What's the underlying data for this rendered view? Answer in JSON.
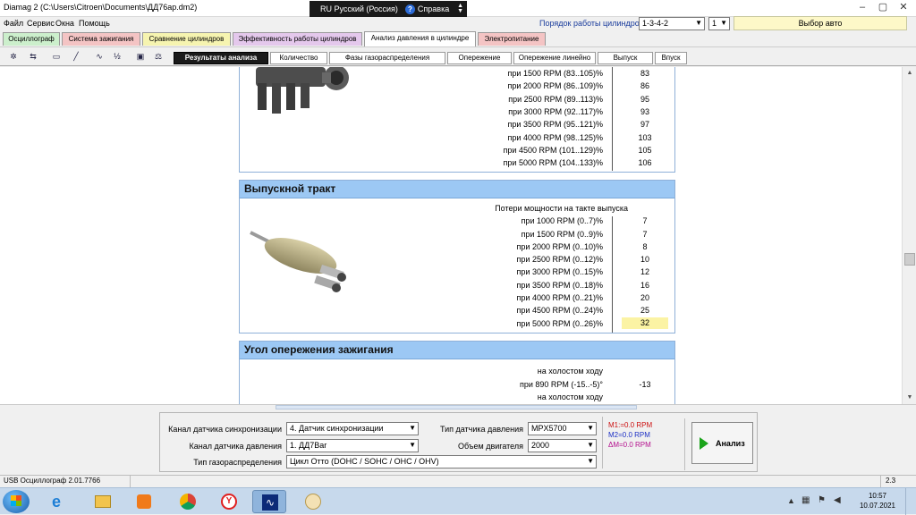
{
  "window": {
    "title": "Diamag 2 (C:\\Users\\Citroen\\Documents\\ДД76ар.dm2)"
  },
  "langbar": {
    "language": "RU Русский (Россия)",
    "help": "Справка"
  },
  "menu": [
    "Файл",
    "Сервис",
    "Окна",
    "Помощь"
  ],
  "cylinders": {
    "label": "Порядок работы цилиндров",
    "order": "1-3-4-2",
    "number": "1",
    "choose_auto": "Выбор авто"
  },
  "tabs": [
    {
      "label": "Осциллограф",
      "color": "#ccefcc"
    },
    {
      "label": "Система зажигания",
      "color": "#f4c4c4"
    },
    {
      "label": "Сравнение цилиндров",
      "color": "#f6f4b0"
    },
    {
      "label": "Эффективность работы цилиндров",
      "color": "#e4c8ec"
    },
    {
      "label": "Анализ давления в цилиндре",
      "color": "#ffffff"
    },
    {
      "label": "Электропитание",
      "color": "#f4c4c4"
    }
  ],
  "toolbar": {
    "icons": [
      "signal-icon",
      "sync-icon",
      "auto-icon",
      "zoom-icon",
      "wave-icon",
      "algorithm-icon",
      "save-icon",
      "scales-icon"
    ],
    "icon_glyphs": [
      "✲",
      "⇆",
      "▭",
      "╱",
      "∿",
      "½",
      "▣",
      "⚖"
    ],
    "subtabs": [
      "Результаты анализа",
      "Количество",
      "Фазы газораспределения",
      "Опережение",
      "Опережение линейно",
      "Выпуск",
      "Впуск"
    ]
  },
  "intake": {
    "rows": [
      {
        "label": "при  1500 RPM (83..105)%",
        "value": "83"
      },
      {
        "label": "при  2000 RPM (86..109)%",
        "value": "86"
      },
      {
        "label": "при  2500 RPM (89..113)%",
        "value": "95"
      },
      {
        "label": "при  3000 RPM (92..117)%",
        "value": "93"
      },
      {
        "label": "при  3500 RPM (95..121)%",
        "value": "97"
      },
      {
        "label": "при  4000 RPM (98..125)%",
        "value": "103"
      },
      {
        "label": "при  4500 RPM (101..129)%",
        "value": "105"
      },
      {
        "label": "при  5000 RPM (104..133)%",
        "value": "106"
      }
    ]
  },
  "exhaust": {
    "title": "Выпускной тракт",
    "caption": "Потери мощности на такте выпуска",
    "rows": [
      {
        "label": "при  1000 RPM (0..7)%",
        "value": "7"
      },
      {
        "label": "при  1500 RPM (0..9)%",
        "value": "7"
      },
      {
        "label": "при  2000 RPM (0..10)%",
        "value": "8"
      },
      {
        "label": "при  2500 RPM (0..12)%",
        "value": "10"
      },
      {
        "label": "при  3000 RPM (0..15)%",
        "value": "12"
      },
      {
        "label": "при  3500 RPM (0..18)%",
        "value": "16"
      },
      {
        "label": "при  4000 RPM (0..21)%",
        "value": "20"
      },
      {
        "label": "при  4500 RPM (0..24)%",
        "value": "25"
      },
      {
        "label": "при  5000 RPM (0..26)%",
        "value": "32"
      }
    ]
  },
  "ignition": {
    "title": "Угол опережения зажигания",
    "rows": [
      {
        "label": "на холостом ходу",
        "value": ""
      },
      {
        "label": "при 890 RPM (-15..-5)°",
        "value": "-13"
      },
      {
        "label": "на холостом ходу",
        "value": ""
      }
    ]
  },
  "bottom": {
    "sync_label": "Канал датчика синхронизации",
    "sync_value": "4.  Датчик синхронизации",
    "pressure_label": "Канал датчика давления",
    "pressure_value": "1.  ДД7Bar",
    "timing_label": "Тип газораспределения",
    "timing_value": "Цикл Отто (DOHC / SOHC / OHC / OHV)",
    "sensor_type_label": "Тип датчика давления",
    "sensor_type_value": "MPX5700",
    "engine_volume_label": "Объем двигателя",
    "engine_volume_value": "2000",
    "m1": "M1:=0.0 RPM",
    "m2": "M2=0.0 RPM",
    "dm": "ΔM=0.0 RPM",
    "analyze": "Анализ"
  },
  "status": {
    "left": "USB Осциллограф  2.01.7766",
    "right": "2.3"
  },
  "taskbar": {
    "time": "10:57",
    "date": "10.07.2021"
  }
}
